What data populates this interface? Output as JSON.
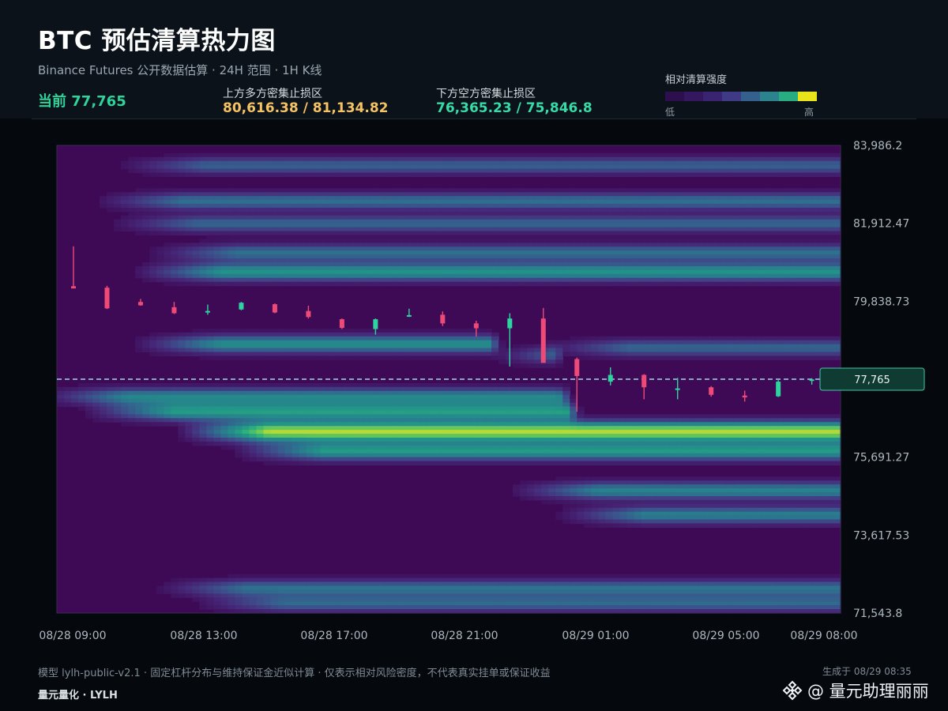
{
  "header": {
    "title": "BTC 预估清算热力图",
    "subtitle": "Binance Futures 公开数据估算 · 24H 范围 · 1H K线",
    "current_text": "当前 77,765",
    "upper_label": "上方多方密集止损区",
    "upper_value": "80,616.38 / 81,134.82",
    "lower_label": "下方空方密集止损区",
    "lower_value": "76,365.23 / 75,846.8"
  },
  "legend": {
    "title": "相对清算强度",
    "low": "低",
    "high": "高",
    "colors": [
      "#2d0f4e",
      "#34175f",
      "#3a2371",
      "#3f3a85",
      "#355f8d",
      "#2c838e",
      "#27ad81",
      "#e8e419"
    ]
  },
  "colors": {
    "up": "#2fd3a0",
    "down": "#ee4a78",
    "current_line": "#9fd8e6",
    "current_box_fill": "#0f3b33",
    "current_box_stroke": "#3dc9a4",
    "upper_value": "#f5c264",
    "lower_value": "#36dba8"
  },
  "chart_data": {
    "type": "heatmap",
    "overlay": "candlestick",
    "x_ticks": [
      "08/28 09:00",
      "08/28 13:00",
      "08/28 17:00",
      "08/28 21:00",
      "08/29 01:00",
      "08/29 05:00",
      "08/29 08:00"
    ],
    "y_ticks": [
      "83,986.2",
      "81,912.47",
      "79,838.73",
      "77,765",
      "75,691.27",
      "73,617.53",
      "71,543.8"
    ],
    "ylim": [
      71543.8,
      83986.2
    ],
    "current_price": 77765,
    "current_price_label": "77,765",
    "candles": [
      {
        "o": 80240,
        "h": 81300,
        "l": 80180,
        "c": 80180
      },
      {
        "o": 80200,
        "h": 80250,
        "l": 79630,
        "c": 79650
      },
      {
        "o": 79820,
        "h": 79900,
        "l": 79720,
        "c": 79730
      },
      {
        "o": 79680,
        "h": 79820,
        "l": 79500,
        "c": 79520
      },
      {
        "o": 79560,
        "h": 79750,
        "l": 79480,
        "c": 79580
      },
      {
        "o": 79620,
        "h": 79820,
        "l": 79600,
        "c": 79800
      },
      {
        "o": 79760,
        "h": 79780,
        "l": 79520,
        "c": 79540
      },
      {
        "o": 79580,
        "h": 79720,
        "l": 79380,
        "c": 79420
      },
      {
        "o": 79360,
        "h": 79380,
        "l": 79100,
        "c": 79130
      },
      {
        "o": 79100,
        "h": 79380,
        "l": 78950,
        "c": 79360
      },
      {
        "o": 79440,
        "h": 79640,
        "l": 79420,
        "c": 79470
      },
      {
        "o": 79480,
        "h": 79570,
        "l": 79180,
        "c": 79250
      },
      {
        "o": 79250,
        "h": 79320,
        "l": 78900,
        "c": 79120
      },
      {
        "o": 79120,
        "h": 79520,
        "l": 78100,
        "c": 79380
      },
      {
        "o": 79380,
        "h": 79660,
        "l": 78300,
        "c": 78200
      },
      {
        "o": 78300,
        "h": 78340,
        "l": 76900,
        "c": 77850
      },
      {
        "o": 77700,
        "h": 78080,
        "l": 77600,
        "c": 77880
      },
      {
        "o": 77880,
        "h": 77900,
        "l": 77230,
        "c": 77550
      },
      {
        "o": 77500,
        "h": 77800,
        "l": 77230,
        "c": 77520
      },
      {
        "o": 77550,
        "h": 77580,
        "l": 77300,
        "c": 77350
      },
      {
        "o": 77330,
        "h": 77460,
        "l": 77170,
        "c": 77280
      },
      {
        "o": 77310,
        "h": 77740,
        "l": 77290,
        "c": 77700
      },
      {
        "o": 77720,
        "h": 77790,
        "l": 77620,
        "c": 77760
      }
    ],
    "bands": [
      {
        "price": 81900,
        "intensity": 0.38,
        "from": 0.09
      },
      {
        "price": 82500,
        "intensity": 0.42,
        "from": 0.07
      },
      {
        "price": 83450,
        "intensity": 0.36,
        "from": 0.1
      },
      {
        "price": 80620,
        "intensity": 0.58,
        "from": 0.12
      },
      {
        "price": 81130,
        "intensity": 0.42,
        "from": 0.14
      },
      {
        "price": 78700,
        "intensity": 0.56,
        "from": 0.12,
        "to": 0.55
      },
      {
        "price": 78400,
        "intensity": 0.5,
        "from": 0.58,
        "to": 0.63
      },
      {
        "price": 78600,
        "intensity": 0.38,
        "from": 0.64
      },
      {
        "price": 77300,
        "intensity": 0.5,
        "from": 0.0,
        "to": 0.64
      },
      {
        "price": 76900,
        "intensity": 0.6,
        "from": 0.06,
        "to": 0.65
      },
      {
        "price": 76370,
        "intensity": 0.92,
        "from": 0.18
      },
      {
        "price": 75850,
        "intensity": 0.6,
        "from": 0.25
      },
      {
        "price": 74800,
        "intensity": 0.5,
        "from": 0.6
      },
      {
        "price": 74150,
        "intensity": 0.48,
        "from": 0.66
      },
      {
        "price": 72200,
        "intensity": 0.42,
        "from": 0.15
      },
      {
        "price": 71800,
        "intensity": 0.38,
        "from": 0.2
      }
    ]
  },
  "footer": {
    "note": "模型 lylh-public-v2.1 · 固定杠杆分布与维持保证金近似计算 · 仅表示相对风险密度，不代表真实挂单或保证收益",
    "brand": "量元量化 · LYLH",
    "generated": "生成于 08/29 08:35",
    "watermark": "@ 量元助理丽丽"
  }
}
